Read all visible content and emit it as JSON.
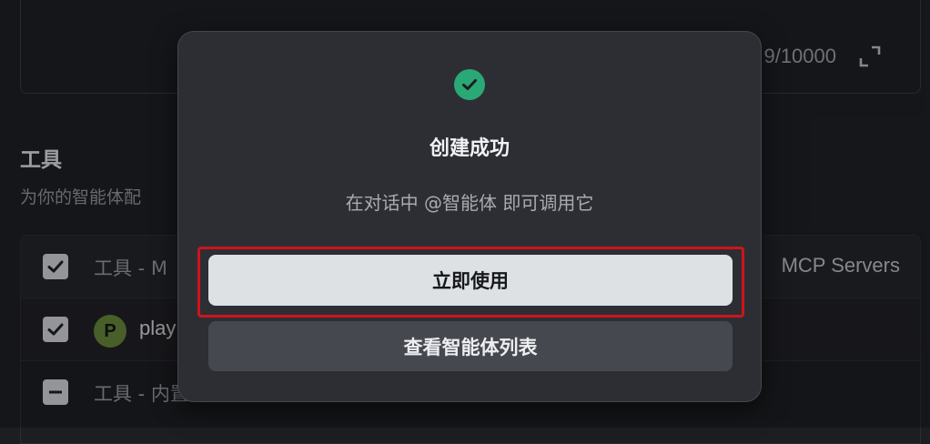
{
  "editor": {
    "char_count": "9/10000",
    "expand_icon": "expand-icon"
  },
  "tools_section": {
    "title": "工具",
    "description": "为你的智能体配"
  },
  "tools_list": {
    "rows": [
      {
        "label": "工具 - M",
        "right_text": "MCP Servers",
        "checked": true
      },
      {
        "avatar_letter": "P",
        "name": "play",
        "checked": true
      },
      {
        "label": "工具 - 内置",
        "checked": "indeterminate"
      }
    ]
  },
  "modal": {
    "icon": "check-circle-icon",
    "title": "创建成功",
    "subtitle": "在对话中 @智能体 即可调用它",
    "primary_button": "立即使用",
    "secondary_button": "查看智能体列表"
  },
  "colors": {
    "accent_success": "#2aa876",
    "highlight": "#d0131c"
  }
}
